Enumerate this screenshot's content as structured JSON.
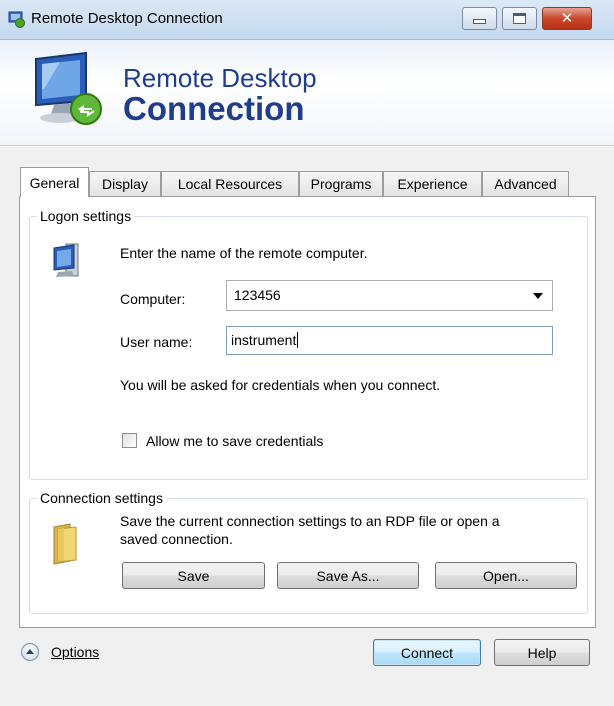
{
  "window": {
    "title": "Remote Desktop Connection",
    "controls": {
      "minimize": "minimize",
      "maximize": "maximize",
      "close": "✕"
    }
  },
  "banner": {
    "line1": "Remote Desktop",
    "line2": "Connection"
  },
  "tabs": [
    {
      "label": "General",
      "active": true
    },
    {
      "label": "Display",
      "active": false
    },
    {
      "label": "Local Resources",
      "active": false
    },
    {
      "label": "Programs",
      "active": false
    },
    {
      "label": "Experience",
      "active": false
    },
    {
      "label": "Advanced",
      "active": false
    }
  ],
  "logon": {
    "group_label": "Logon settings",
    "instruction": "Enter the name of the remote computer.",
    "computer_label": "Computer:",
    "computer_value": "123456",
    "username_label": "User name:",
    "username_value": "instrument",
    "credentials_note": "You will be asked for credentials when you connect.",
    "save_credentials_label": "Allow me to save credentials",
    "save_credentials_checked": false
  },
  "connection": {
    "group_label": "Connection settings",
    "description_line1": "Save the current connection settings to an RDP file or open a",
    "description_line2": "saved connection.",
    "save_label": "Save",
    "save_as_label": "Save As...",
    "open_label": "Open..."
  },
  "footer": {
    "options_label": "Options",
    "connect_label": "Connect",
    "help_label": "Help"
  },
  "icons": {
    "app": "remote-desktop-icon",
    "banner": "remote-desktop-monitor-icon",
    "logon": "computer-icon",
    "connection": "folder-icon",
    "options": "chevron-up-circle-icon"
  },
  "colors": {
    "banner_text": "#1f3d8b",
    "close_button": "#c9462c"
  }
}
